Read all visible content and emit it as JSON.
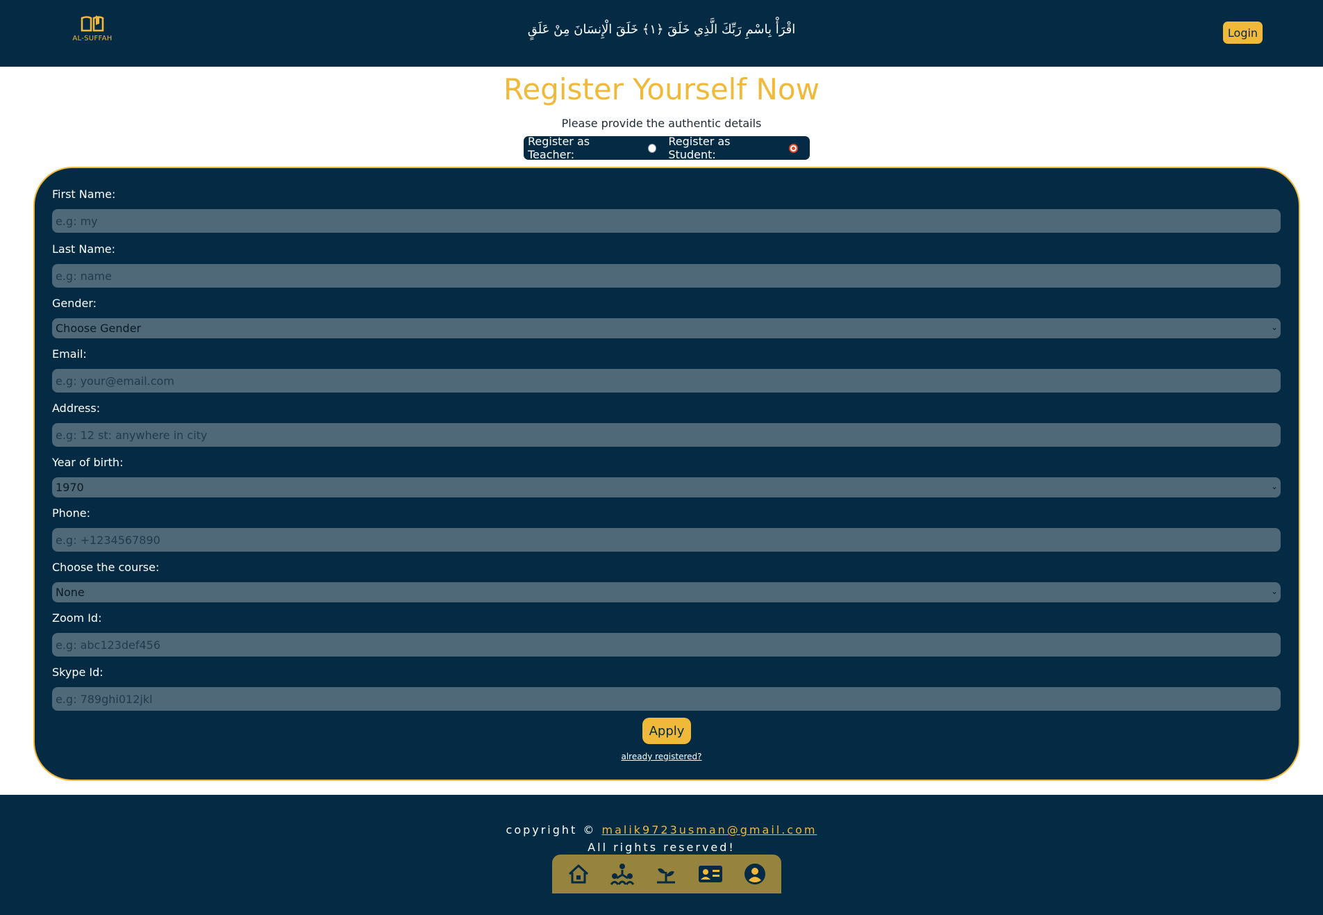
{
  "header": {
    "logo_text": "AL-SUFFAH",
    "verse": "اقْرَأْ بِاسْمِ رَبِّكَ الَّذِي خَلَقَ ﴿١﴾ خَلَقَ الْإِنسَانَ مِنْ عَلَقٍ",
    "login_label": "Login"
  },
  "page": {
    "title": "Register Yourself Now",
    "subtitle": "Please provide the authentic details"
  },
  "role": {
    "teacher_label": "Register as Teacher:",
    "student_label": "Register as Student:",
    "selected": "student"
  },
  "form": {
    "first_name": {
      "label": "First Name:",
      "placeholder": "e.g: my",
      "value": ""
    },
    "last_name": {
      "label": "Last Name:",
      "placeholder": "e.g: name",
      "value": ""
    },
    "gender": {
      "label": "Gender:",
      "selected": "Choose Gender"
    },
    "email": {
      "label": "Email:",
      "placeholder": "e.g: your@email.com",
      "value": ""
    },
    "address": {
      "label": "Address:",
      "placeholder": "e.g: 12 st: anywhere in city",
      "value": ""
    },
    "year_of_birth": {
      "label": "Year of birth:",
      "selected": "1970"
    },
    "phone": {
      "label": "Phone:",
      "placeholder": "e.g: +1234567890",
      "value": ""
    },
    "course": {
      "label": "Choose the course:",
      "selected": "None"
    },
    "zoom_id": {
      "label": "Zoom Id:",
      "placeholder": "e.g: abc123def456",
      "value": ""
    },
    "skype_id": {
      "label": "Skype Id:",
      "placeholder": "e.g: 789ghi012jkl",
      "value": ""
    },
    "apply_label": "Apply",
    "already_registered": "already registered?"
  },
  "footer": {
    "copyright_prefix": "copyright © ",
    "email": "malik9723usman@gmail.com",
    "rights": "All rights reserved!",
    "nav_icons": [
      "home-icon",
      "community-icon",
      "growth-icon",
      "contact-card-icon",
      "profile-icon"
    ]
  },
  "colors": {
    "navy": "#052a44",
    "accent": "#f0b939",
    "field_bg": "#4f6979",
    "radio_checked": "#e24a2c"
  }
}
